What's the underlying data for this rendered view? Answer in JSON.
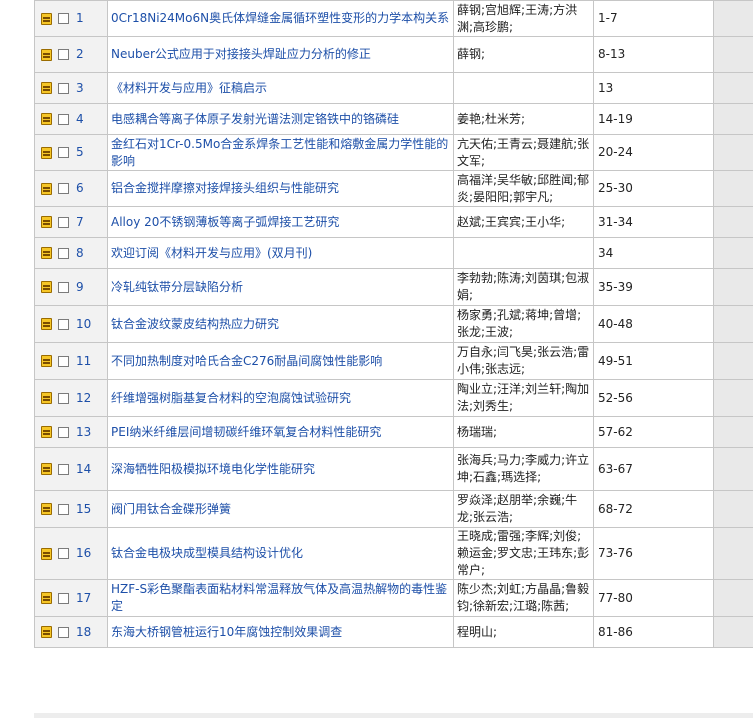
{
  "articles": [
    {
      "num": "1",
      "title": "0Cr18Ni24Mo6N奥氏体焊缝金属循环塑性变形的力学本构关系",
      "authors": "薛钢;宫旭辉;王涛;方洪渊;高珍鹏;",
      "pages": "1-7"
    },
    {
      "num": "2",
      "title": "Neuber公式应用于对接接头焊趾应力分析的修正",
      "authors": "薛钢;",
      "pages": "8-13"
    },
    {
      "num": "3",
      "title": "《材料开发与应用》征稿启示",
      "authors": "",
      "pages": "13"
    },
    {
      "num": "4",
      "title": "电感耦合等离子体原子发射光谱法测定铬铁中的铬磷硅",
      "authors": "姜艳;杜米芳;",
      "pages": "14-19"
    },
    {
      "num": "5",
      "title": "金红石对1Cr-0.5Mo合金系焊条工艺性能和熔敷金属力学性能的影响",
      "authors": "亢天佑;王青云;聂建航;张文军;",
      "pages": "20-24"
    },
    {
      "num": "6",
      "title": "铝合金搅拌摩擦对接焊接头组织与性能研究",
      "authors": "高福洋;吴华敏;邱胜闻;郁炎;晏阳阳;郭宇凡;",
      "pages": "25-30"
    },
    {
      "num": "7",
      "title": "Alloy 20不锈钢薄板等离子弧焊接工艺研究",
      "authors": "赵斌;王宾宾;王小华;",
      "pages": "31-34"
    },
    {
      "num": "8",
      "title": "欢迎订阅《材料开发与应用》(双月刊)",
      "authors": "",
      "pages": "34"
    },
    {
      "num": "9",
      "title": "冷轧纯钛带分层缺陷分析",
      "authors": "李勃勃;陈涛;刘茵琪;包淑娟;",
      "pages": "35-39"
    },
    {
      "num": "10",
      "title": "钛合金波纹蒙皮结构热应力研究",
      "authors": "杨家勇;孔斌;蒋坤;曾增;张龙;王波;",
      "pages": "40-48"
    },
    {
      "num": "11",
      "title": "不同加热制度对哈氏合金C276耐晶间腐蚀性能影响",
      "authors": "万自永;闫飞昊;张云浩;雷小伟;张志远;",
      "pages": "49-51"
    },
    {
      "num": "12",
      "title": "纤维增强树脂基复合材料的空泡腐蚀试验研究",
      "authors": "陶业立;汪洋;刘兰轩;陶加法;刘秀生;",
      "pages": "52-56"
    },
    {
      "num": "13",
      "title": "PEI纳米纤维层间增韧碳纤维环氧复合材料性能研究",
      "authors": "杨瑞瑞;",
      "pages": "57-62"
    },
    {
      "num": "14",
      "title": "深海牺牲阳极模拟环境电化学性能研究",
      "authors": "张海兵;马力;李威力;许立坤;石鑫;瑪选择;",
      "pages": "63-67"
    },
    {
      "num": "15",
      "title": "阀门用钛合金碟形弹簧",
      "authors": "罗焱泽;赵朋举;余巍;牛龙;张云浩;",
      "pages": "68-72"
    },
    {
      "num": "16",
      "title": "钛合金电极块成型模具结构设计优化",
      "authors": "王晓成;雷强;李辉;刘俊;赖运金;罗文忠;王玮东;彭常户;",
      "pages": "73-76"
    },
    {
      "num": "17",
      "title": "HZF-S彩色聚酯表面粘材料常温释放气体及高温热解物的毒性鉴定",
      "authors": "陈少杰;刘虹;方晶晶;鲁毅钧;徐新宏;江璐;陈茜;",
      "pages": "77-80"
    },
    {
      "num": "18",
      "title": "东海大桥钢管桩运行10年腐蚀控制效果调查",
      "authors": "程明山;",
      "pages": "81-86"
    }
  ]
}
